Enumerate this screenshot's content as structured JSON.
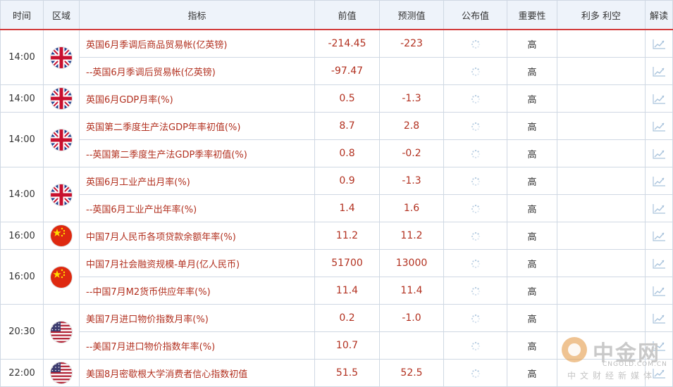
{
  "headers": {
    "time": "时间",
    "region": "区域",
    "indicator": "指标",
    "previous": "前值",
    "forecast": "预测值",
    "actual": "公布值",
    "importance": "重要性",
    "impact": "利多 利空",
    "interpret": "解读"
  },
  "groups": [
    {
      "time": "14:00",
      "flag": "uk-flag-icon",
      "rows": [
        {
          "indicator": "英国6月季调后商品贸易帐(亿英镑)",
          "previous": "-214.45",
          "forecast": "-223",
          "importance": "高"
        },
        {
          "indicator": "--英国6月季调后贸易帐(亿英镑)",
          "previous": "-97.47",
          "forecast": "",
          "importance": "高"
        }
      ]
    },
    {
      "time": "14:00",
      "flag": "uk-flag-icon",
      "rows": [
        {
          "indicator": "英国6月GDP月率(%)",
          "previous": "0.5",
          "forecast": "-1.3",
          "importance": "高"
        }
      ]
    },
    {
      "time": "14:00",
      "flag": "uk-flag-icon",
      "rows": [
        {
          "indicator": "英国第二季度生产法GDP年率初值(%)",
          "previous": "8.7",
          "forecast": "2.8",
          "importance": "高"
        },
        {
          "indicator": "--英国第二季度生产法GDP季率初值(%)",
          "previous": "0.8",
          "forecast": "-0.2",
          "importance": "高"
        }
      ]
    },
    {
      "time": "14:00",
      "flag": "uk-flag-icon",
      "rows": [
        {
          "indicator": "英国6月工业产出月率(%)",
          "previous": "0.9",
          "forecast": "-1.3",
          "importance": "高"
        },
        {
          "indicator": "--英国6月工业产出年率(%)",
          "previous": "1.4",
          "forecast": "1.6",
          "importance": "高"
        }
      ]
    },
    {
      "time": "16:00",
      "flag": "china-flag-icon",
      "rows": [
        {
          "indicator": "中国7月人民币各项贷款余额年率(%)",
          "previous": "11.2",
          "forecast": "11.2",
          "importance": "高"
        }
      ]
    },
    {
      "time": "16:00",
      "flag": "china-flag-icon",
      "rows": [
        {
          "indicator": "中国7月社会融资规模-单月(亿人民币)",
          "previous": "51700",
          "forecast": "13000",
          "importance": "高"
        },
        {
          "indicator": "--中国7月M2货币供应年率(%)",
          "previous": "11.4",
          "forecast": "11.4",
          "importance": "高"
        }
      ]
    },
    {
      "time": "20:30",
      "flag": "us-flag-icon",
      "rows": [
        {
          "indicator": "美国7月进口物价指数月率(%)",
          "previous": "0.2",
          "forecast": "-1.0",
          "importance": "高"
        },
        {
          "indicator": "--美国7月进口物价指数年率(%)",
          "previous": "10.7",
          "forecast": "",
          "importance": "高"
        }
      ]
    },
    {
      "time": "22:00",
      "flag": "us-flag-icon",
      "rows": [
        {
          "indicator": "美国8月密歇根大学消费者信心指数初值",
          "previous": "51.5",
          "forecast": "52.5",
          "importance": "高"
        }
      ]
    }
  ],
  "watermark": {
    "name": "中金网",
    "domain": "CNGOLD.COM.CN",
    "tagline": "中文财经新媒体"
  },
  "colors": {
    "header_bg": "#eef3fa",
    "header_rule": "#d23b3b",
    "value_text": "#b2301f",
    "border": "#cfd8e3"
  }
}
